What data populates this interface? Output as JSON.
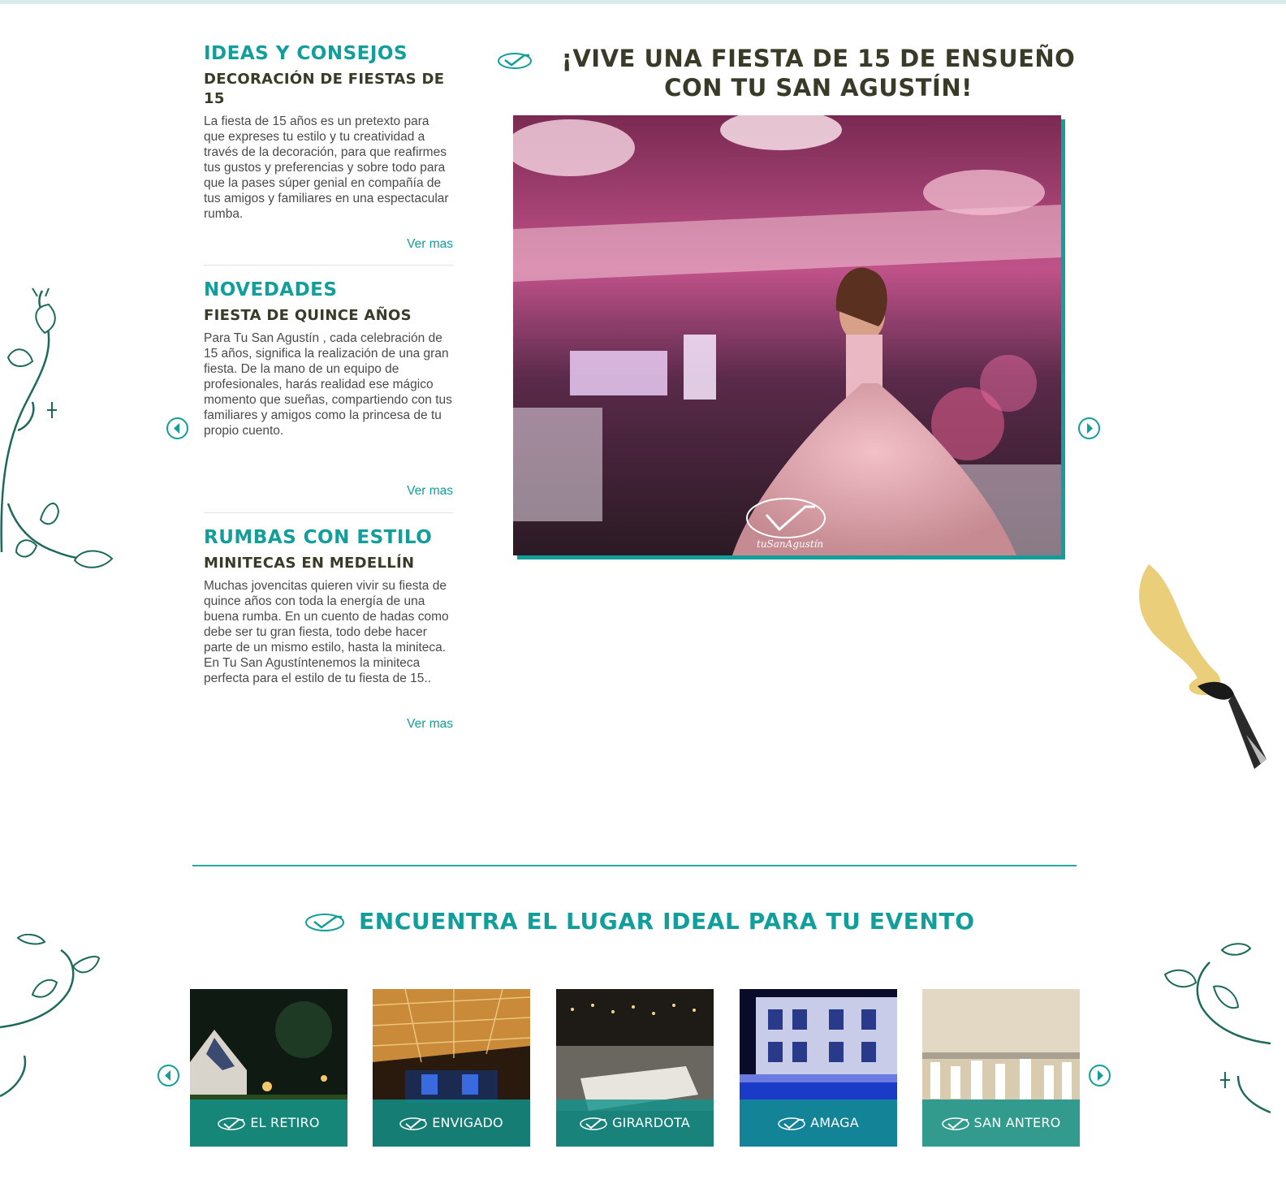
{
  "articles": [
    {
      "category": "IDEAS Y CONSEJOS",
      "title": "DECORACIÓN DE FIESTAS DE 15",
      "body": "La fiesta de 15 años es un pretexto para que expreses tu estilo y tu creatividad a través de la decoración, para que reafirmes tus gustos y preferencias y sobre todo para que la pases súper genial en compañía de tus amigos y familiares en una espectacular rumba.",
      "link": "Ver mas"
    },
    {
      "category": "NOVEDADES",
      "title": "FIESTA DE QUINCE AÑOS",
      "body": "Para Tu San Agustín , cada celebración de 15 años, significa la realización de una gran fiesta. De la mano de un equipo de profesionales, harás realidad ese mágico momento que sueñas, compartiendo con tus familiares y amigos como la princesa de tu propio cuento.",
      "link": "Ver mas"
    },
    {
      "category": "RUMBAS CON ESTILO",
      "title": "MINITECAS EN MEDELLÍN",
      "body": "Muchas jovencitas quieren vivir su fiesta de quince años con toda la energía de una buena rumba. En un cuento de hadas como debe ser tu gran fiesta, todo debe hacer parte de un mismo estilo, hasta la miniteca. En Tu San Agustíntenemos la miniteca perfecta para el estilo de tu fiesta de 15..",
      "link": "Ver mas"
    }
  ],
  "hero": {
    "title": "¡VIVE UNA FIESTA DE 15 DE ENSUEÑO CON TU SAN AGUSTÍN!",
    "watermark": "tuSanAgustín"
  },
  "venues_section": {
    "title": "ENCUENTRA EL LUGAR IDEAL PARA TU EVENTO",
    "venues": [
      "EL RETIRO",
      "ENVIGADO",
      "GIRARDOTA",
      "AMAGA",
      "SAN ANTERO"
    ]
  },
  "icons": {
    "prev": "chevron-left-icon",
    "next": "chevron-right-icon",
    "brand": "swoosh-logo-icon"
  },
  "colors": {
    "accent": "#129e9a",
    "heading": "#3a3a28",
    "text": "#4a4a4a"
  }
}
